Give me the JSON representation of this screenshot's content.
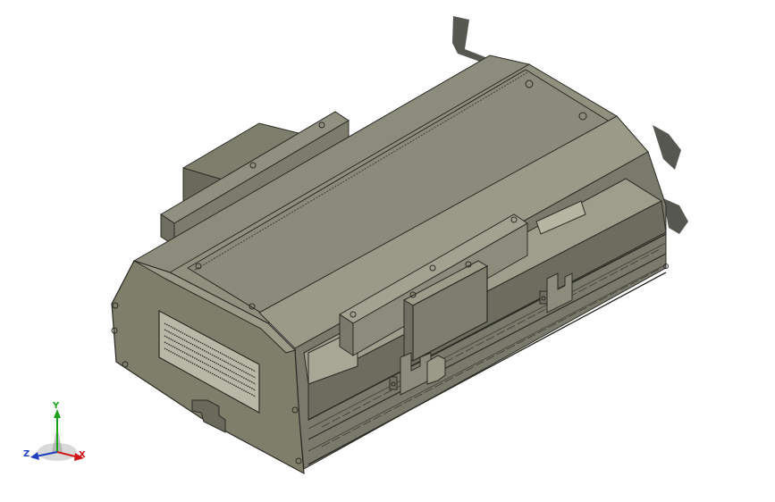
{
  "view": {
    "background": "#ffffff",
    "model_colors": {
      "body_top": "#8f8f80",
      "body_side": "#75756a",
      "body_end": "#82826f",
      "dark": "#58584e",
      "edge": "#2b2b26",
      "shadow": "#3a3a34"
    }
  },
  "triad": {
    "x_label": "X",
    "y_label": "Y",
    "z_label": "Z",
    "x_color": "#d01818",
    "y_color": "#1aa21a",
    "z_color": "#1f3fbf"
  },
  "nameplate": {
    "text_lines": 8
  }
}
